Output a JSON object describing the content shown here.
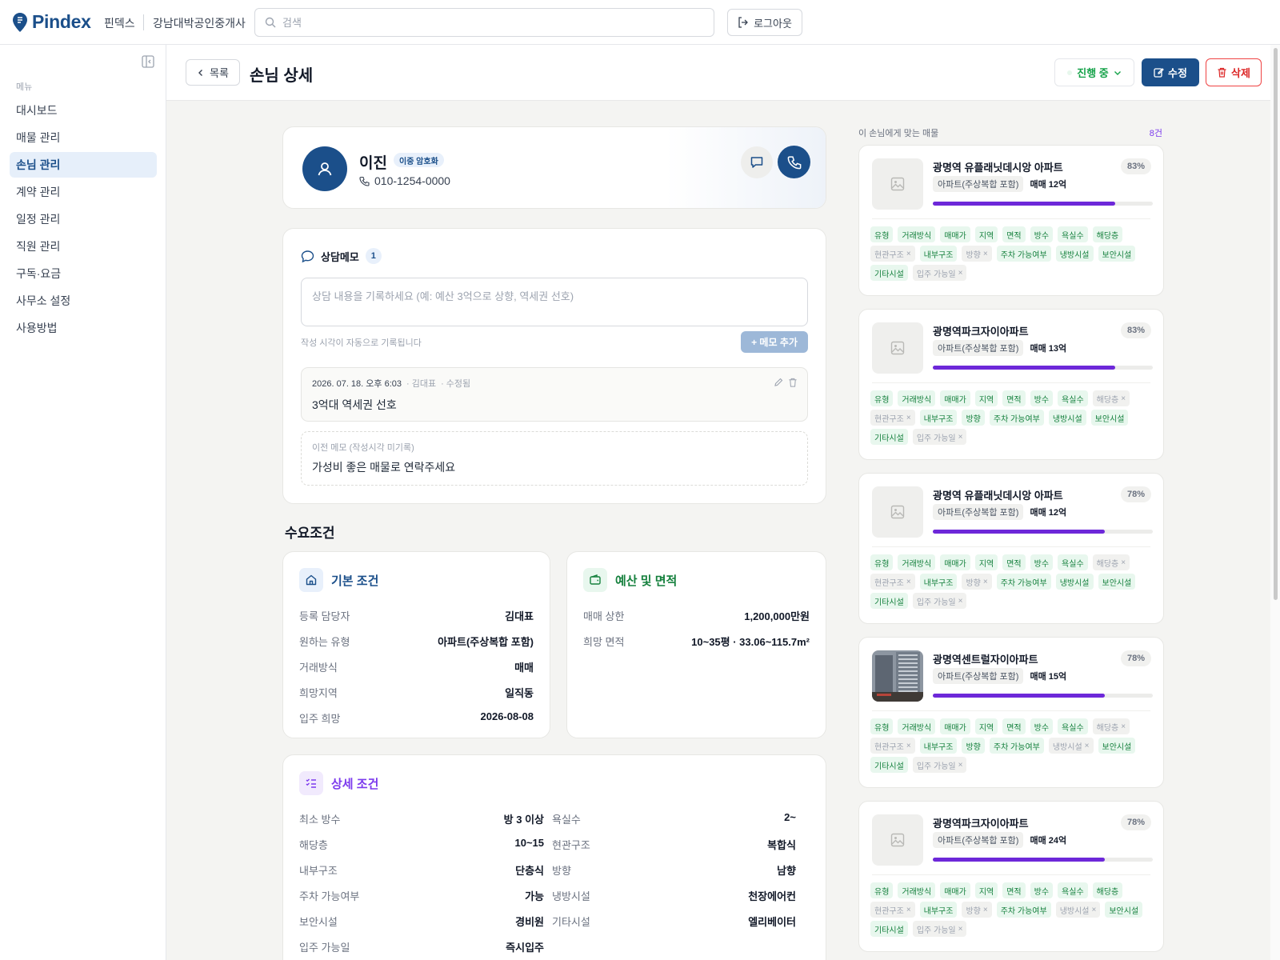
{
  "header": {
    "logo_text": "Pindex",
    "brand_kr": "핀덱스",
    "office_name": "강남대박공인중개사",
    "search_placeholder": "검색",
    "logout_label": "로그아웃"
  },
  "sidebar": {
    "menu_heading": "메뉴",
    "items": [
      {
        "label": "대시보드",
        "active": false
      },
      {
        "label": "매물 관리",
        "active": false
      },
      {
        "label": "손님 관리",
        "active": true
      },
      {
        "label": "계약 관리",
        "active": false
      },
      {
        "label": "일정 관리",
        "active": false
      },
      {
        "label": "직원 관리",
        "active": false
      },
      {
        "label": "구독·요금",
        "active": false
      },
      {
        "label": "사무소 설정",
        "active": false
      },
      {
        "label": "사용방법",
        "active": false
      }
    ]
  },
  "page": {
    "back_label": "목록",
    "title": "손님 상세",
    "status": "진행 중",
    "edit_label": "수정",
    "delete_label": "삭제"
  },
  "customer": {
    "name": "이진",
    "badge": "이중 암호화",
    "phone": "010-1254-0000"
  },
  "memo": {
    "title": "상담메모",
    "count": "1",
    "placeholder": "상담 내용을 기록하세요 (예: 예산 3억으로 상향, 역세권 선호)",
    "hint": "작성 시각이 자동으로 기록됩니다",
    "add_label": "+ 메모 추가",
    "entry": {
      "date": "2026. 07. 18. 오후 6:03",
      "author": "· 김대표",
      "edited": "· 수정됨",
      "text": "3억대 역세권 선호"
    },
    "old": {
      "label": "이전 메모 (작성시각 미기록)",
      "text": "가성비 좋은 매물로 연락주세요"
    }
  },
  "conditions": {
    "section_title": "수요조건",
    "basic": {
      "title": "기본 조건",
      "rows": [
        {
          "k": "등록 담당자",
          "v": "김대표"
        },
        {
          "k": "원하는 유형",
          "v": "아파트(주상복합 포함)"
        },
        {
          "k": "거래방식",
          "v": "매매"
        },
        {
          "k": "희망지역",
          "v": "일직동"
        },
        {
          "k": "입주 희망",
          "v": "2026-08-08"
        }
      ]
    },
    "budget": {
      "title": "예산 및 면적",
      "rows": [
        {
          "k": "매매 상한",
          "v": "1,200,000만원"
        },
        {
          "k": "희망 면적",
          "v": "10~35평 · 33.06~115.7m²"
        }
      ]
    },
    "detail": {
      "title": "상세 조건",
      "left": [
        {
          "k": "최소 방수",
          "v": "방 3 이상"
        },
        {
          "k": "해당층",
          "v": "10~15"
        },
        {
          "k": "내부구조",
          "v": "단층식"
        },
        {
          "k": "주차 가능여부",
          "v": "가능"
        },
        {
          "k": "보안시설",
          "v": "경비원"
        },
        {
          "k": "입주 가능일",
          "v": "즉시입주"
        }
      ],
      "right": [
        {
          "k": "욕실수",
          "v": "2~"
        },
        {
          "k": "현관구조",
          "v": "복합식"
        },
        {
          "k": "방향",
          "v": "남향"
        },
        {
          "k": "냉방시설",
          "v": "천장에어컨"
        },
        {
          "k": "기타시설",
          "v": "엘리베이터"
        }
      ]
    }
  },
  "matches": {
    "heading": "이 손님에게 맞는 매물",
    "count": "8건",
    "bar_color": "#6d28d9",
    "items": [
      {
        "title": "광명역 유플래닛데시앙 아파트",
        "score": "83%",
        "score_value": 83,
        "type": "아파트(주상복합 포함)",
        "price": "매매 12억",
        "photo": false,
        "chips": [
          [
            "유형",
            1
          ],
          [
            "거래방식",
            1
          ],
          [
            "매매가",
            1
          ],
          [
            "지역",
            1
          ],
          [
            "면적",
            1
          ],
          [
            "방수",
            1
          ],
          [
            "욕실수",
            1
          ],
          [
            "해당층",
            1
          ],
          [
            "현관구조",
            0
          ],
          [
            "내부구조",
            1
          ],
          [
            "방향",
            0
          ],
          [
            "주차 가능여부",
            1
          ],
          [
            "냉방시설",
            1
          ],
          [
            "보안시설",
            1
          ],
          [
            "기타시설",
            1
          ],
          [
            "입주 가능일",
            0
          ]
        ]
      },
      {
        "title": "광명역파크자이아파트",
        "score": "83%",
        "score_value": 83,
        "type": "아파트(주상복합 포함)",
        "price": "매매 13억",
        "photo": false,
        "chips": [
          [
            "유형",
            1
          ],
          [
            "거래방식",
            1
          ],
          [
            "매매가",
            1
          ],
          [
            "지역",
            1
          ],
          [
            "면적",
            1
          ],
          [
            "방수",
            1
          ],
          [
            "욕실수",
            1
          ],
          [
            "해당층",
            0
          ],
          [
            "현관구조",
            0
          ],
          [
            "내부구조",
            1
          ],
          [
            "방향",
            1
          ],
          [
            "주차 가능여부",
            1
          ],
          [
            "냉방시설",
            1
          ],
          [
            "보안시설",
            1
          ],
          [
            "기타시설",
            1
          ],
          [
            "입주 가능일",
            0
          ]
        ]
      },
      {
        "title": "광명역 유플래닛데시앙 아파트",
        "score": "78%",
        "score_value": 78,
        "type": "아파트(주상복합 포함)",
        "price": "매매 12억",
        "photo": false,
        "chips": [
          [
            "유형",
            1
          ],
          [
            "거래방식",
            1
          ],
          [
            "매매가",
            1
          ],
          [
            "지역",
            1
          ],
          [
            "면적",
            1
          ],
          [
            "방수",
            1
          ],
          [
            "욕실수",
            1
          ],
          [
            "해당층",
            0
          ],
          [
            "현관구조",
            0
          ],
          [
            "내부구조",
            1
          ],
          [
            "방향",
            0
          ],
          [
            "주차 가능여부",
            1
          ],
          [
            "냉방시설",
            1
          ],
          [
            "보안시설",
            1
          ],
          [
            "기타시설",
            1
          ],
          [
            "입주 가능일",
            0
          ]
        ]
      },
      {
        "title": "광명역센트럴자이아파트",
        "score": "78%",
        "score_value": 78,
        "type": "아파트(주상복합 포함)",
        "price": "매매 15억",
        "photo": true,
        "chips": [
          [
            "유형",
            1
          ],
          [
            "거래방식",
            1
          ],
          [
            "매매가",
            1
          ],
          [
            "지역",
            1
          ],
          [
            "면적",
            1
          ],
          [
            "방수",
            1
          ],
          [
            "욕실수",
            1
          ],
          [
            "해당층",
            0
          ],
          [
            "현관구조",
            0
          ],
          [
            "내부구조",
            1
          ],
          [
            "방향",
            1
          ],
          [
            "주차 가능여부",
            1
          ],
          [
            "냉방시설",
            0
          ],
          [
            "보안시설",
            1
          ],
          [
            "기타시설",
            1
          ],
          [
            "입주 가능일",
            0
          ]
        ]
      },
      {
        "title": "광명역파크자이아파트",
        "score": "78%",
        "score_value": 78,
        "type": "아파트(주상복합 포함)",
        "price": "매매 24억",
        "photo": false,
        "chips": [
          [
            "유형",
            1
          ],
          [
            "거래방식",
            1
          ],
          [
            "매매가",
            1
          ],
          [
            "지역",
            1
          ],
          [
            "면적",
            1
          ],
          [
            "방수",
            1
          ],
          [
            "욕실수",
            1
          ],
          [
            "해당층",
            1
          ],
          [
            "현관구조",
            0
          ],
          [
            "내부구조",
            1
          ],
          [
            "방향",
            0
          ],
          [
            "주차 가능여부",
            1
          ],
          [
            "냉방시설",
            0
          ],
          [
            "보안시설",
            1
          ],
          [
            "기타시설",
            1
          ],
          [
            "입주 가능일",
            0
          ]
        ]
      }
    ]
  }
}
